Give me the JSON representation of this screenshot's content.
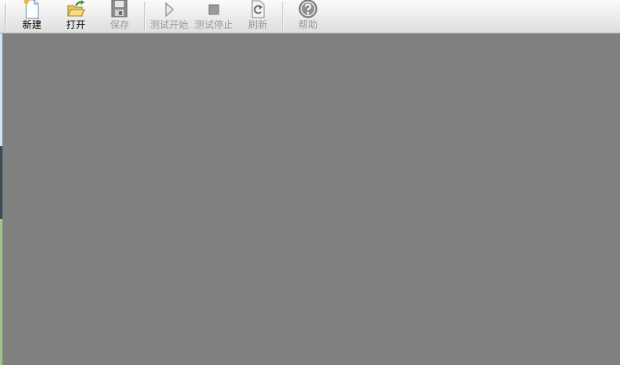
{
  "toolbar": {
    "buttons": [
      {
        "label": "新建",
        "icon": "new-file-icon",
        "enabled": true
      },
      {
        "label": "打开",
        "icon": "open-folder-icon",
        "enabled": true
      },
      {
        "label": "保存",
        "icon": "save-disk-icon",
        "enabled": false
      },
      {
        "label": "测试开始",
        "icon": "play-icon",
        "enabled": false
      },
      {
        "label": "测试停止",
        "icon": "stop-icon",
        "enabled": false
      },
      {
        "label": "刷新",
        "icon": "refresh-icon",
        "enabled": false
      },
      {
        "label": "帮助",
        "icon": "help-icon",
        "enabled": false
      }
    ]
  },
  "colors": {
    "workspace": "#808080",
    "toolbar_top": "#fbfbfb",
    "toolbar_bottom": "#dedede",
    "disabled_text": "#9a9a9a"
  }
}
